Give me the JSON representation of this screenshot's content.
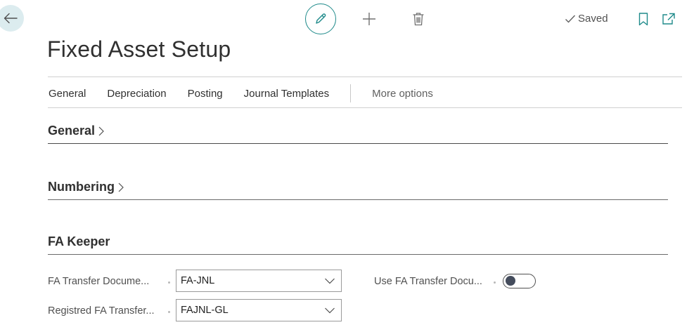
{
  "page": {
    "title": "Fixed Asset Setup"
  },
  "actions": {
    "saved_label": "Saved"
  },
  "tabs": [
    {
      "label": "General"
    },
    {
      "label": "Depreciation"
    },
    {
      "label": "Posting"
    },
    {
      "label": "Journal Templates"
    }
  ],
  "more_options_label": "More options",
  "sections": {
    "general": {
      "title": "General"
    },
    "numbering": {
      "title": "Numbering"
    },
    "fa_keeper": {
      "title": "FA Keeper"
    }
  },
  "fields": {
    "fa_transfer_document": {
      "label": "FA Transfer Docume...",
      "value": "FA-JNL"
    },
    "registred_fa_transfer": {
      "label": "Registred FA Transfer...",
      "value": "FAJNL-GL"
    },
    "use_fa_transfer_doc": {
      "label": "Use FA Transfer Docu...",
      "checked": false
    }
  },
  "colors": {
    "accent": "#1e8a8a",
    "back_button_bg": "#dcecef",
    "toggle_knob": "#444c5c"
  },
  "icons": {
    "back": "arrow-left-icon",
    "edit": "pencil-icon",
    "new": "plus-icon",
    "delete": "trash-icon",
    "saved": "checkmark-icon",
    "bookmark": "bookmark-icon",
    "popout": "open-in-new-window-icon",
    "expand": "chevron-right-icon",
    "dropdown": "chevron-down-icon"
  }
}
